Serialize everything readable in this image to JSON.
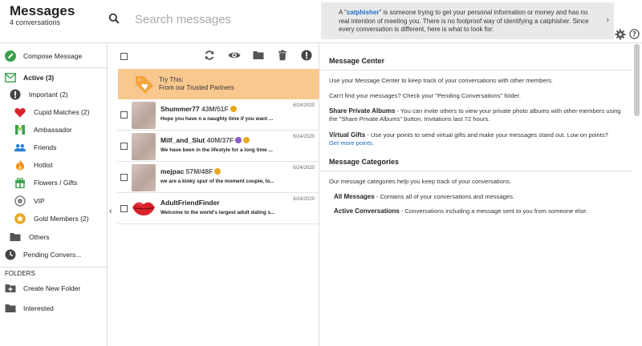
{
  "header": {
    "title": "Messages",
    "subtitle": "4 conversations",
    "search_placeholder": "Search messages"
  },
  "info_banner": {
    "prefix": "A \"",
    "highlight": "catphisher",
    "middle": "\" is someone trying to get your personal information or money and has no real intention of meeting you. There is no foolproof way of identifying a catphisher. Since every conversation is different, here is what to look for:",
    "chevron": "›"
  },
  "sidebar": {
    "compose": "Compose Message",
    "active": "Active (3)",
    "important": "Important (2)",
    "cupid_matches": "Cupid Matches (2)",
    "ambassador": "Ambassador",
    "friends": "Friends",
    "hotlist": "Hotlist",
    "flowers": "Flowers / Gifts",
    "vip": "VIP",
    "gold_members": "Gold Members (2)",
    "others": "Others",
    "pending": "Pending Convers...",
    "folders_header": "FOLDERS",
    "create_folder": "Create New Folder",
    "interested": "Interested"
  },
  "colors": {
    "compose_green": "#3aa14b",
    "active_green": "#3aa14b",
    "heart_red": "#d8232a",
    "friends_blue": "#2a7fd4",
    "hot_orange": "#f08a1c",
    "gold": "#e8a91f",
    "promo_bg": "#f8c88f",
    "link_blue": "#1a6cc2"
  },
  "promo": {
    "line1": "Try This:",
    "line2": "From our Trusted Partners"
  },
  "messages": [
    {
      "name": "Shummer77",
      "age": "43M/51F",
      "date": "6/24/2020",
      "preview": "Hope you have n a naughty time if you want ..."
    },
    {
      "name": "Milf_and_Slut",
      "age": "40M/37F",
      "date": "6/24/2020",
      "preview": "We have been in the lifestyle for a long time ..."
    },
    {
      "name": "mejpac",
      "age": "57M/48F",
      "date": "6/24/2020",
      "preview": "we are a kinky spur of the moment couple, lo..."
    },
    {
      "name": "AdultFriendFinder",
      "age": "",
      "date": "6/24/2020",
      "preview": "Welcome to the world's largest adult dating s..."
    }
  ],
  "content": {
    "message_center_title": "Message Center",
    "p1": "Use your Message Center to keep track of your conversations with other members.",
    "p2": "Can't find your messages? Check your \"Pending Conversations\" folder.",
    "share_title": "Share Private Albums",
    "share_text": " - You can invite others to view your private photo albums with other members using the \"Share Private Albums\" button. Invitations last 72 hours.",
    "gifts_title": "Virtual Gifts",
    "gifts_text": " - Use your points to send virtual gifts and make your messages stand out. Low on points?",
    "gifts_link": "Get more points.",
    "categories_title": "Message Categories",
    "p3": "Our message categories help you keep track of your conversations.",
    "all_title": "All Messages",
    "all_text": " - Contains all of your conversations and messages.",
    "active_title": "Active Conversations",
    "active_text": " - Conversations including a message sent to you from someone else."
  }
}
